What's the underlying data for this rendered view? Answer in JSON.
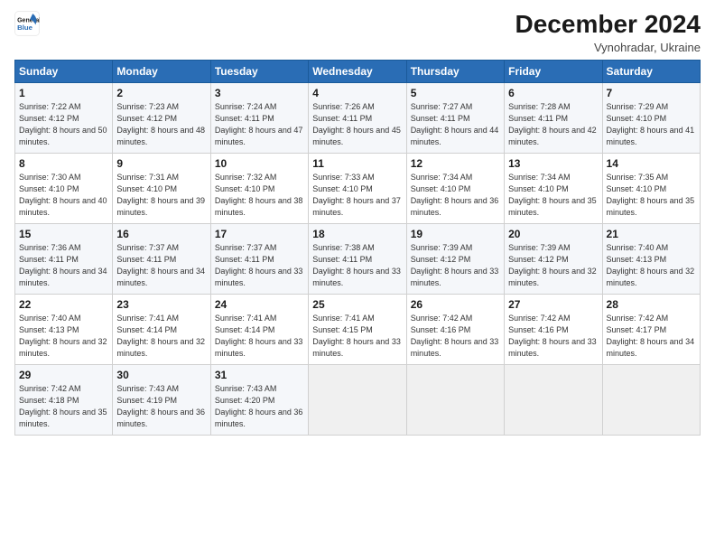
{
  "header": {
    "logo_line1": "General",
    "logo_line2": "Blue",
    "month_title": "December 2024",
    "subtitle": "Vynohradar, Ukraine"
  },
  "days_of_week": [
    "Sunday",
    "Monday",
    "Tuesday",
    "Wednesday",
    "Thursday",
    "Friday",
    "Saturday"
  ],
  "weeks": [
    [
      {
        "day": "1",
        "sunrise": "7:22 AM",
        "sunset": "4:12 PM",
        "daylight": "8 hours and 50 minutes."
      },
      {
        "day": "2",
        "sunrise": "7:23 AM",
        "sunset": "4:12 PM",
        "daylight": "8 hours and 48 minutes."
      },
      {
        "day": "3",
        "sunrise": "7:24 AM",
        "sunset": "4:11 PM",
        "daylight": "8 hours and 47 minutes."
      },
      {
        "day": "4",
        "sunrise": "7:26 AM",
        "sunset": "4:11 PM",
        "daylight": "8 hours and 45 minutes."
      },
      {
        "day": "5",
        "sunrise": "7:27 AM",
        "sunset": "4:11 PM",
        "daylight": "8 hours and 44 minutes."
      },
      {
        "day": "6",
        "sunrise": "7:28 AM",
        "sunset": "4:11 PM",
        "daylight": "8 hours and 42 minutes."
      },
      {
        "day": "7",
        "sunrise": "7:29 AM",
        "sunset": "4:10 PM",
        "daylight": "8 hours and 41 minutes."
      }
    ],
    [
      {
        "day": "8",
        "sunrise": "7:30 AM",
        "sunset": "4:10 PM",
        "daylight": "8 hours and 40 minutes."
      },
      {
        "day": "9",
        "sunrise": "7:31 AM",
        "sunset": "4:10 PM",
        "daylight": "8 hours and 39 minutes."
      },
      {
        "day": "10",
        "sunrise": "7:32 AM",
        "sunset": "4:10 PM",
        "daylight": "8 hours and 38 minutes."
      },
      {
        "day": "11",
        "sunrise": "7:33 AM",
        "sunset": "4:10 PM",
        "daylight": "8 hours and 37 minutes."
      },
      {
        "day": "12",
        "sunrise": "7:34 AM",
        "sunset": "4:10 PM",
        "daylight": "8 hours and 36 minutes."
      },
      {
        "day": "13",
        "sunrise": "7:34 AM",
        "sunset": "4:10 PM",
        "daylight": "8 hours and 35 minutes."
      },
      {
        "day": "14",
        "sunrise": "7:35 AM",
        "sunset": "4:10 PM",
        "daylight": "8 hours and 35 minutes."
      }
    ],
    [
      {
        "day": "15",
        "sunrise": "7:36 AM",
        "sunset": "4:11 PM",
        "daylight": "8 hours and 34 minutes."
      },
      {
        "day": "16",
        "sunrise": "7:37 AM",
        "sunset": "4:11 PM",
        "daylight": "8 hours and 34 minutes."
      },
      {
        "day": "17",
        "sunrise": "7:37 AM",
        "sunset": "4:11 PM",
        "daylight": "8 hours and 33 minutes."
      },
      {
        "day": "18",
        "sunrise": "7:38 AM",
        "sunset": "4:11 PM",
        "daylight": "8 hours and 33 minutes."
      },
      {
        "day": "19",
        "sunrise": "7:39 AM",
        "sunset": "4:12 PM",
        "daylight": "8 hours and 33 minutes."
      },
      {
        "day": "20",
        "sunrise": "7:39 AM",
        "sunset": "4:12 PM",
        "daylight": "8 hours and 32 minutes."
      },
      {
        "day": "21",
        "sunrise": "7:40 AM",
        "sunset": "4:13 PM",
        "daylight": "8 hours and 32 minutes."
      }
    ],
    [
      {
        "day": "22",
        "sunrise": "7:40 AM",
        "sunset": "4:13 PM",
        "daylight": "8 hours and 32 minutes."
      },
      {
        "day": "23",
        "sunrise": "7:41 AM",
        "sunset": "4:14 PM",
        "daylight": "8 hours and 32 minutes."
      },
      {
        "day": "24",
        "sunrise": "7:41 AM",
        "sunset": "4:14 PM",
        "daylight": "8 hours and 33 minutes."
      },
      {
        "day": "25",
        "sunrise": "7:41 AM",
        "sunset": "4:15 PM",
        "daylight": "8 hours and 33 minutes."
      },
      {
        "day": "26",
        "sunrise": "7:42 AM",
        "sunset": "4:16 PM",
        "daylight": "8 hours and 33 minutes."
      },
      {
        "day": "27",
        "sunrise": "7:42 AM",
        "sunset": "4:16 PM",
        "daylight": "8 hours and 33 minutes."
      },
      {
        "day": "28",
        "sunrise": "7:42 AM",
        "sunset": "4:17 PM",
        "daylight": "8 hours and 34 minutes."
      }
    ],
    [
      {
        "day": "29",
        "sunrise": "7:42 AM",
        "sunset": "4:18 PM",
        "daylight": "8 hours and 35 minutes."
      },
      {
        "day": "30",
        "sunrise": "7:43 AM",
        "sunset": "4:19 PM",
        "daylight": "8 hours and 36 minutes."
      },
      {
        "day": "31",
        "sunrise": "7:43 AM",
        "sunset": "4:20 PM",
        "daylight": "8 hours and 36 minutes."
      },
      null,
      null,
      null,
      null
    ]
  ]
}
